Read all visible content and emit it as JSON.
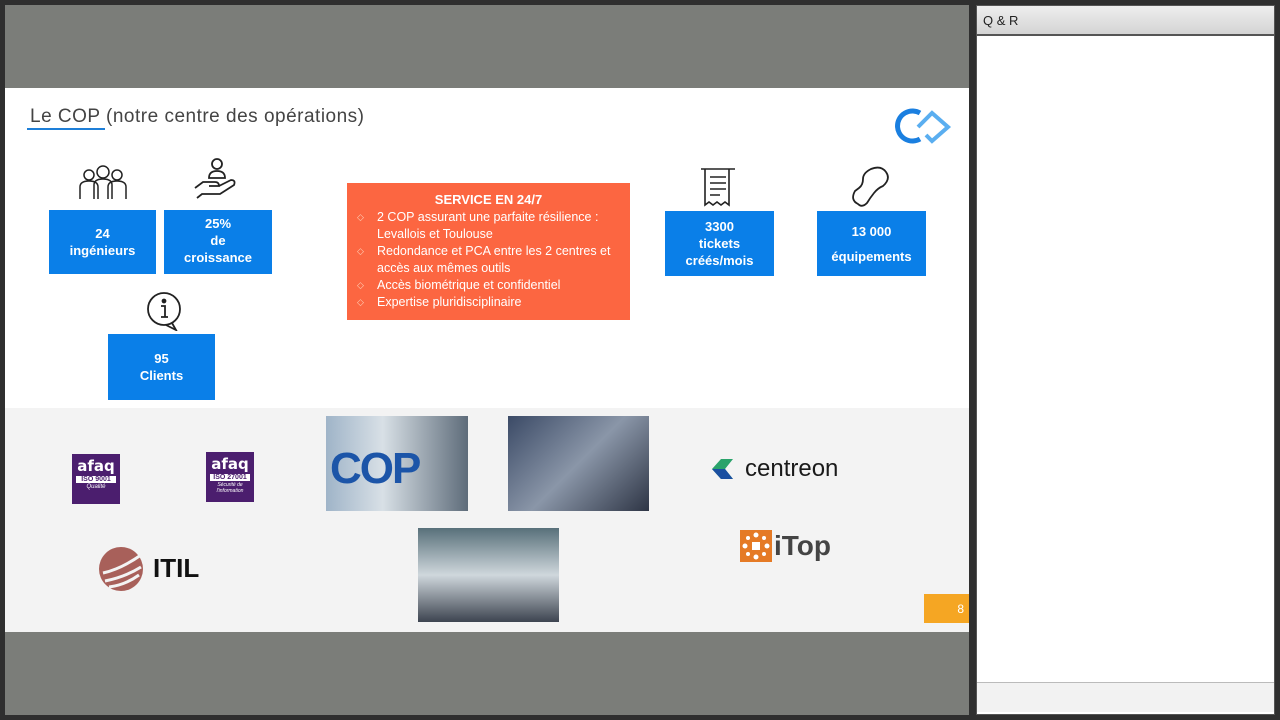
{
  "panel": {
    "title": "Q & R"
  },
  "slide": {
    "title_prefix": "Le COP",
    "title_rest": " (notre centre des opérations)",
    "stats": [
      {
        "value": "24",
        "label": "ingénieurs"
      },
      {
        "value": "25%",
        "label": "de",
        "label2": "croissance"
      },
      {
        "value": "95",
        "label": "Clients"
      },
      {
        "value": "3300",
        "label": "tickets",
        "label2": "créés/mois"
      },
      {
        "value": "13 000",
        "label": "équipements"
      }
    ],
    "service": {
      "heading": "SERVICE EN 24/7",
      "items": [
        "2 COP assurant une parfaite résilience : Levallois et Toulouse",
        "Redondance et PCA entre les 2 centres et accès aux mêmes outils",
        "Accès biométrique et confidentiel",
        "Expertise pluridisciplinaire"
      ]
    },
    "logos": {
      "afaq1": "afaq",
      "iso1": "ISO 9001",
      "afaq1_sub": "Qualité",
      "afaq2": "afaq",
      "iso2": "ISO 27001",
      "afaq2_sub": "Sécurité de l'information",
      "itil": "ITIL",
      "centreon": "centreon",
      "itop": "iTop",
      "cop_sign": "COP"
    },
    "page_number": "8"
  }
}
